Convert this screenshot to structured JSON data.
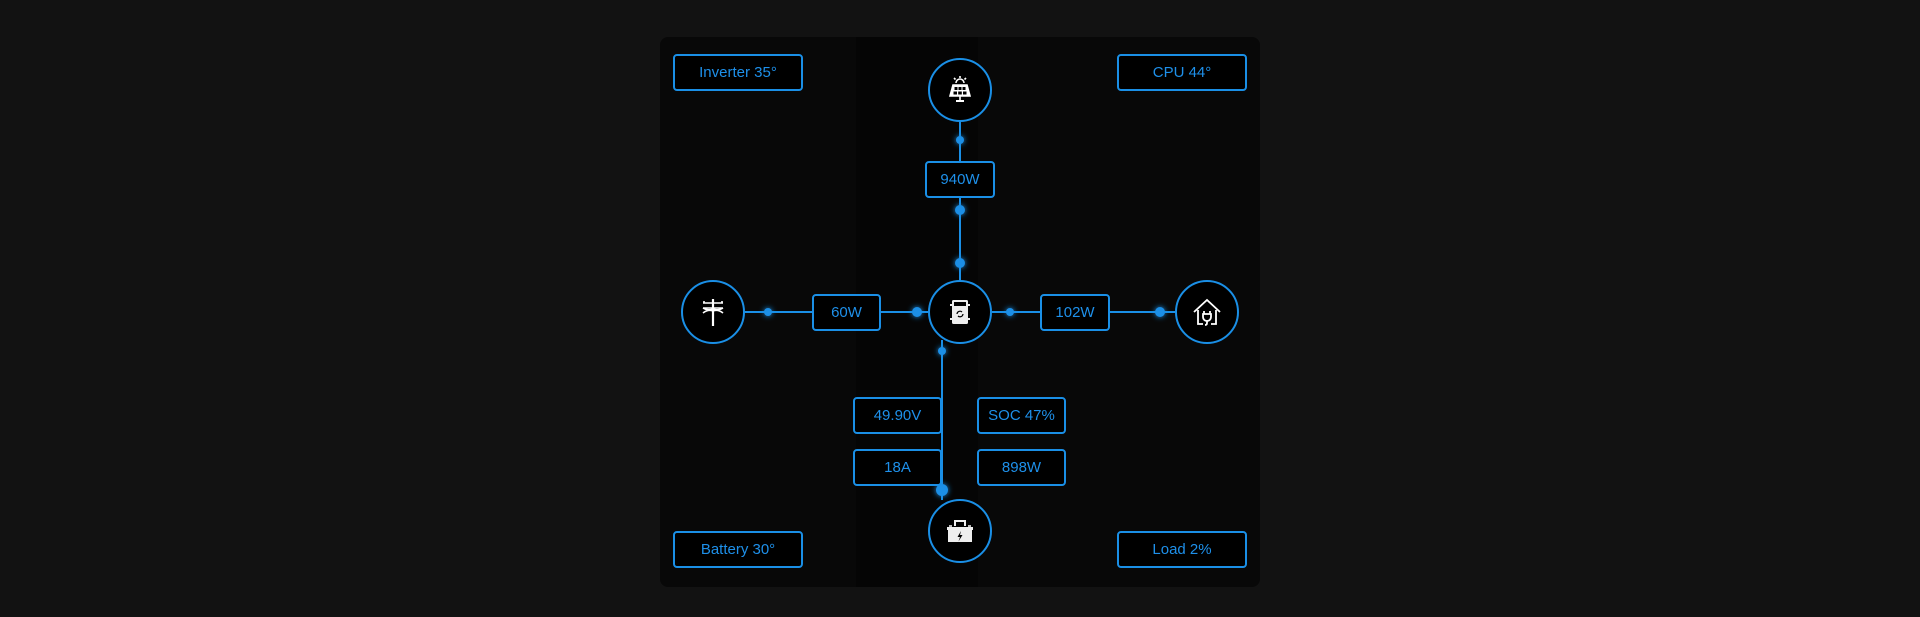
{
  "colors": {
    "accent": "#1a8fe6",
    "background": "#121212",
    "panel": "#080808",
    "icon": "#ffffff"
  },
  "temps": {
    "inverter": "Inverter 35°",
    "cpu": "CPU 44°",
    "battery": "Battery 30°",
    "load": "Load 2%"
  },
  "flows": {
    "solar_power": "940W",
    "grid_power": "60W",
    "load_power": "102W"
  },
  "battery": {
    "voltage": "49.90V",
    "current": "18A",
    "soc": "SOC 47%",
    "power": "898W"
  },
  "nodes": {
    "solar": "solar-panel-icon",
    "grid": "power-pole-icon",
    "inverter": "inverter-icon",
    "home": "home-plug-icon",
    "battery": "battery-icon"
  }
}
